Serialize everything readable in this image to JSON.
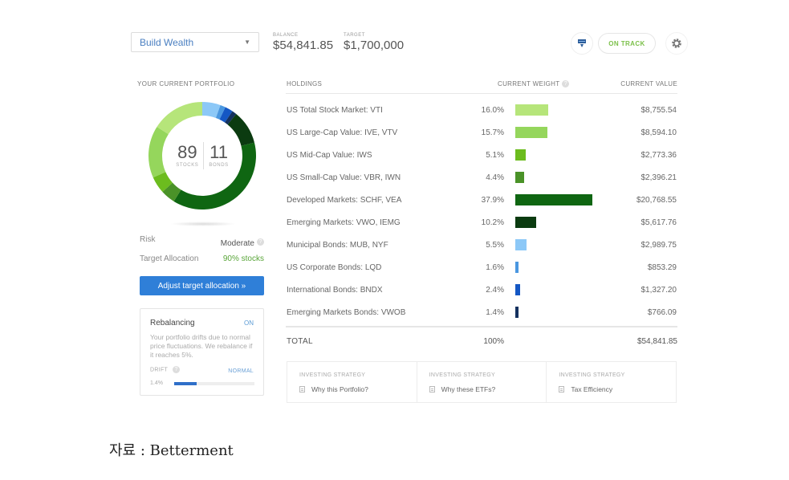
{
  "header": {
    "goal_select": "Build Wealth",
    "balance_label": "BALANCE",
    "balance_value": "$54,841.85",
    "target_label": "TARGET",
    "target_value": "$1,700,000",
    "status_badge": "ON TRACK",
    "icons": [
      "export-icon",
      "gear-icon"
    ],
    "accent_color": "#2f7fd8",
    "status_color": "#7cc04a"
  },
  "portfolio": {
    "title": "YOUR CURRENT PORTFOLIO",
    "stocks_pct": "89",
    "stocks_label": "STOCKS",
    "bonds_pct": "11",
    "bonds_label": "BONDS",
    "risk_label": "Risk",
    "risk_value": "Moderate",
    "target_alloc_label": "Target Allocation",
    "target_alloc_value": "90% stocks",
    "adjust_button": "Adjust target allocation »"
  },
  "rebalancing": {
    "title": "Rebalancing",
    "status": "ON",
    "description": "Your portfolio drifts due to normal price fluctuations. We rebalance if it reaches 5%.",
    "drift_label": "DRIFT",
    "drift_status": "NORMAL",
    "drift_value": "1.4%",
    "drift_fraction_of_threshold": 0.28
  },
  "holdings": {
    "columns": [
      "HOLDINGS",
      "CURRENT WEIGHT",
      "CURRENT VALUE"
    ],
    "rows": [
      {
        "name": "US Total Stock Market: VTI",
        "weight": "16.0%",
        "weight_num": 16.0,
        "value": "$8,755.54",
        "color": "#b6e57a"
      },
      {
        "name": "US Large-Cap Value: IVE, VTV",
        "weight": "15.7%",
        "weight_num": 15.7,
        "value": "$8,594.10",
        "color": "#95d65c"
      },
      {
        "name": "US Mid-Cap Value: IWS",
        "weight": "5.1%",
        "weight_num": 5.1,
        "value": "$2,773.36",
        "color": "#6cbc1e"
      },
      {
        "name": "US Small-Cap Value: VBR, IWN",
        "weight": "4.4%",
        "weight_num": 4.4,
        "value": "$2,396.21",
        "color": "#4a9228"
      },
      {
        "name": "Developed Markets: SCHF, VEA",
        "weight": "37.9%",
        "weight_num": 37.9,
        "value": "$20,768.55",
        "color": "#0f6612"
      },
      {
        "name": "Emerging Markets: VWO, IEMG",
        "weight": "10.2%",
        "weight_num": 10.2,
        "value": "$5,617.76",
        "color": "#0b3b10"
      },
      {
        "name": "Municipal Bonds: MUB, NYF",
        "weight": "5.5%",
        "weight_num": 5.5,
        "value": "$2,989.75",
        "color": "#8cc8f7"
      },
      {
        "name": "US Corporate Bonds: LQD",
        "weight": "1.6%",
        "weight_num": 1.6,
        "value": "$853.29",
        "color": "#4a97e0"
      },
      {
        "name": "International Bonds: BNDX",
        "weight": "2.4%",
        "weight_num": 2.4,
        "value": "$1,327.20",
        "color": "#1457c4"
      },
      {
        "name": "Emerging Markets Bonds: VWOB",
        "weight": "1.4%",
        "weight_num": 1.4,
        "value": "$766.09",
        "color": "#14315f"
      }
    ],
    "total_label": "TOTAL",
    "total_weight": "100%",
    "total_value": "$54,841.85"
  },
  "strategy": [
    {
      "label": "INVESTING STRATEGY",
      "link": "Why this Portfolio?"
    },
    {
      "label": "INVESTING STRATEGY",
      "link": "Why these ETFs?"
    },
    {
      "label": "INVESTING STRATEGY",
      "link": "Tax Efficiency"
    }
  ],
  "source": "자료 : Betterment"
}
